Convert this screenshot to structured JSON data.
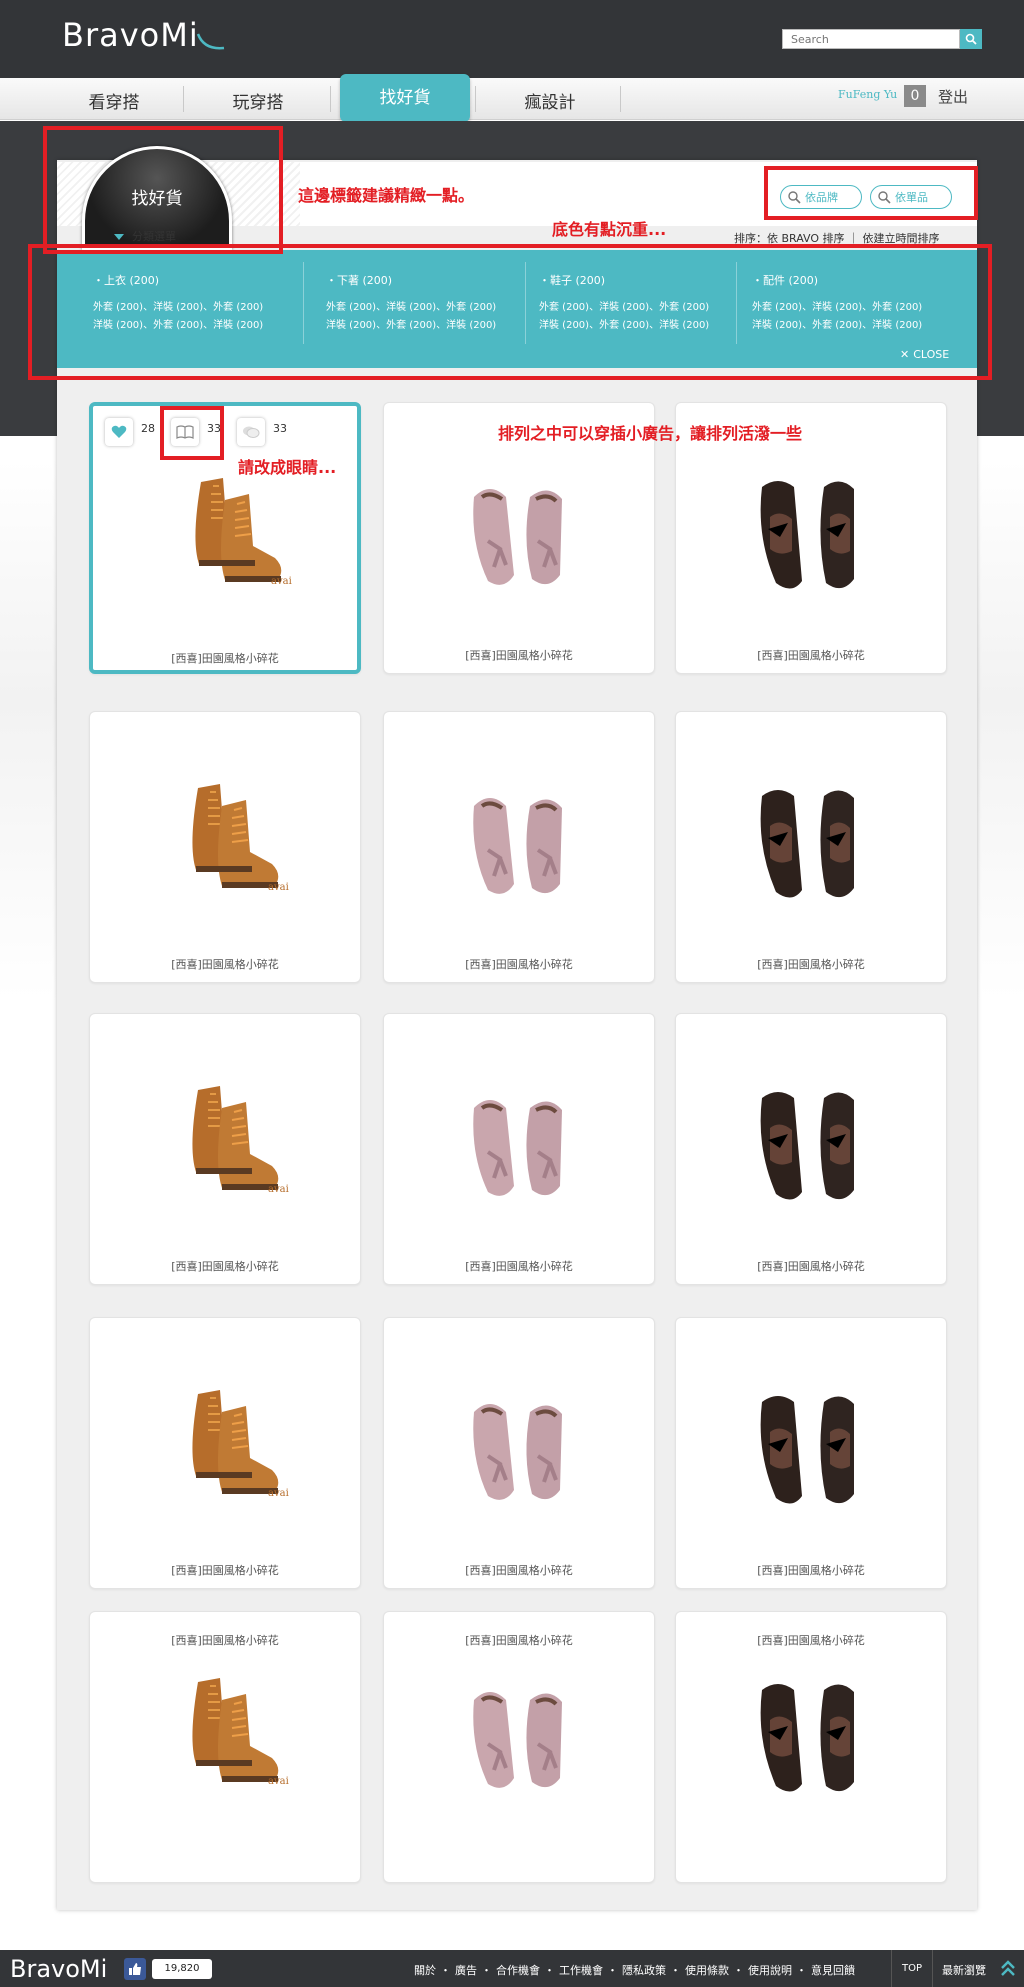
{
  "header": {
    "logo": "BravoMi",
    "search_placeholder": "Search"
  },
  "nav": {
    "tabs": [
      "看穿搭",
      "玩穿搭",
      "找好貨",
      "瘋設計"
    ],
    "active_tab": "找好貨",
    "username": "FuFeng Yu",
    "count": "0",
    "logout": "登出"
  },
  "panel": {
    "badge_title": "找好貨",
    "category_toggle": "分類選單",
    "brand_button": "依品牌",
    "item_button": "依單品",
    "sort_text": "排序：依 BRAVO 排序 ｜ 依建立時間排序",
    "close_label": "CLOSE"
  },
  "categories": [
    {
      "title": "・上衣 (200)",
      "lines": [
        "外套 (200)、洋裝 (200)、外套 (200)",
        "洋裝 (200)、外套 (200)、洋裝 (200)"
      ]
    },
    {
      "title": "・下著 (200)",
      "lines": [
        "外套 (200)、洋裝 (200)、外套 (200)",
        "洋裝 (200)、外套 (200)、洋裝 (200)"
      ]
    },
    {
      "title": "・鞋子 (200)",
      "lines": [
        "外套 (200)、洋裝 (200)、外套 (200)",
        "洋裝 (200)、外套 (200)、洋裝 (200)"
      ]
    },
    {
      "title": "・配件 (200)",
      "lines": [
        "外套 (200)、洋裝 (200)、外套 (200)",
        "洋裝 (200)、外套 (200)、洋裝 (200)"
      ]
    }
  ],
  "first_card_stats": {
    "likes": "28",
    "collects": "33",
    "comments": "33"
  },
  "product_caption": "[西喜]田園風格小碎花",
  "product_images": [
    "brown-lace-up-boots",
    "pink-tassel-loafers",
    "black-lace-oxfords"
  ],
  "annotations": {
    "tag_note": "這邊標籤建議精緻一點。",
    "color_note": "底色有點沉重...",
    "ads_note": "排列之中可以穿插小廣告，讓排列活潑一些",
    "eye_note": "請改成眼睛..."
  },
  "footer": {
    "logo": "BravoMi",
    "like_count": "19,820",
    "links": [
      "關於",
      "廣告",
      "合作機會",
      "工作機會",
      "隱私政策",
      "使用條款",
      "使用說明",
      "意見回饋"
    ],
    "top": "TOP",
    "latest": "最新瀏覽"
  },
  "colors": {
    "accent": "#4db9c3",
    "dark": "#333538",
    "annotation": "#e31e24"
  }
}
